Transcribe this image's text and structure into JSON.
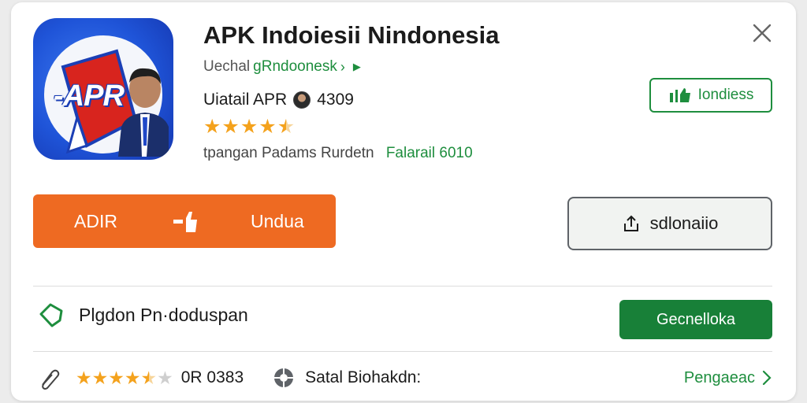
{
  "app": {
    "title": "APK Indoiesii Nindonesia",
    "icon_text": "-APR",
    "developer_prefix": "Uechal",
    "developer_link": "gRndoonesk",
    "publisher_label": "Uiatail APR",
    "rating_value": "4309",
    "stars": 4.5,
    "meta_text": "tpangan Padams Rurdetn",
    "meta_green": "Falarail 6010"
  },
  "buttons": {
    "install_outline": "Iondiess",
    "primary_left": "ADIR",
    "primary_right": "Undua",
    "secondary": "sdlonaiio",
    "green": "Gecnelloka"
  },
  "info": {
    "label": "Plgdon Pn·doduspan"
  },
  "bottom": {
    "stars": 4.5,
    "count": "0R 0383",
    "status": "Satal Biohakdn:",
    "link": "Pengaeac"
  },
  "colors": {
    "accent_green": "#1e8e3e",
    "primary_orange": "#ee6a22",
    "star": "#f4a21d"
  },
  "icons": [
    "close-icon",
    "share-icon",
    "download-icon",
    "shield-icon",
    "pin-icon",
    "gear-icon",
    "chevron-right-icon"
  ]
}
